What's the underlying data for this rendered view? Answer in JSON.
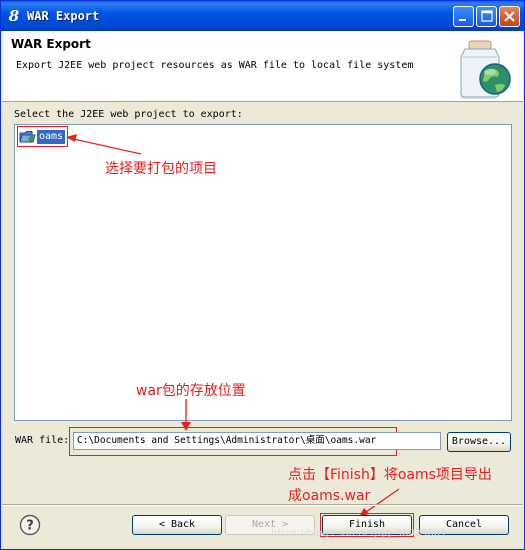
{
  "window": {
    "title": "WAR Export",
    "controls": {
      "minimize_icon": "minimize-icon",
      "maximize_icon": "maximize-icon",
      "close_icon": "close-icon"
    }
  },
  "header": {
    "title": "WAR Export",
    "description": "Export J2EE web project resources as WAR file to local file system",
    "icon": "jar-export-globe-icon"
  },
  "project_select": {
    "label": "Select the J2EE web project to export:",
    "items": [
      {
        "label": "oams",
        "icon": "web-project-folder-icon",
        "selected": true
      }
    ]
  },
  "war_file": {
    "label": "WAR file:",
    "value": "C:\\Documents and Settings\\Administrator\\桌面\\oams.war",
    "browse_label": "Browse..."
  },
  "annotations": {
    "select_project": "选择要打包的项目",
    "war_location": "war包的存放位置",
    "finish_line1": "点击【Finish】将oams项目导出",
    "finish_line2": "成oams.war"
  },
  "buttons": {
    "back": "< Back",
    "next": "Next >",
    "finish": "Finish",
    "cancel": "Cancel"
  },
  "watermark": "https://blog.csdn.net/qq_36029801",
  "colors": {
    "titlebar": "#0055e5",
    "annotation_red": "#e52020",
    "selection": "#316ac5",
    "dialog_bg": "#ece9d8"
  }
}
